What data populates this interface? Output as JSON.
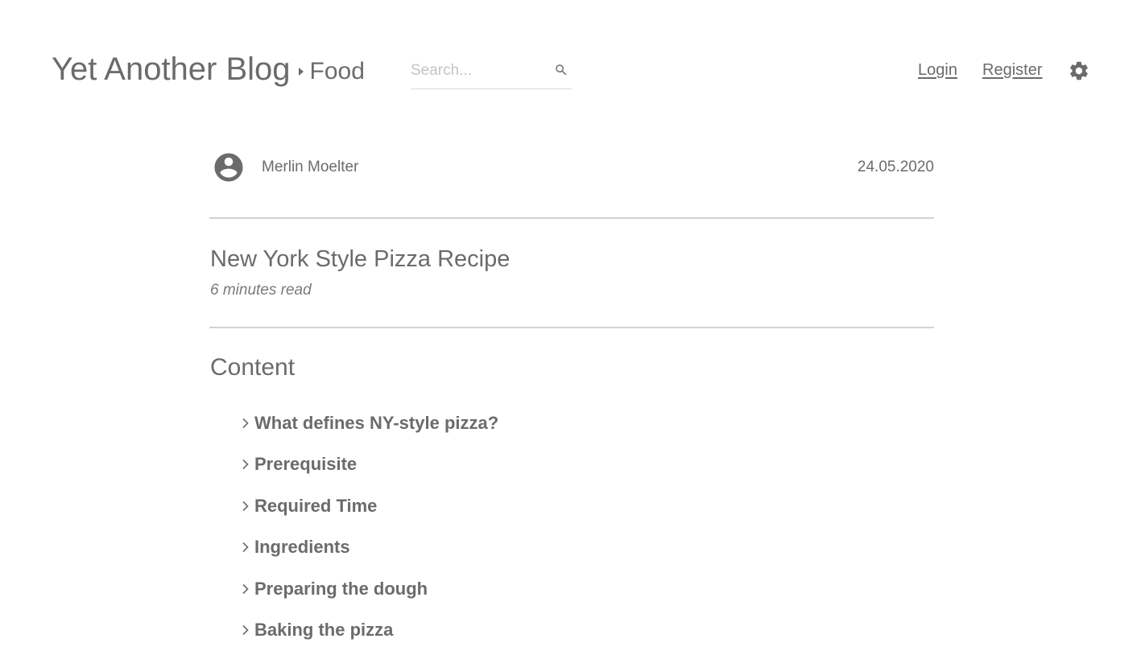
{
  "header": {
    "brand_title": "Yet Another Blog",
    "category": "Food",
    "search_placeholder": "Search...",
    "search_value": "",
    "login_label": "Login",
    "register_label": "Register"
  },
  "post": {
    "author": "Merlin Moelter",
    "date": "24.05.2020",
    "title": "New York Style Pizza Recipe",
    "read_time": "6 minutes read"
  },
  "toc": {
    "heading": "Content",
    "items": [
      {
        "label": "What defines NY-style pizza?"
      },
      {
        "label": "Prerequisite"
      },
      {
        "label": "Required Time"
      },
      {
        "label": "Ingredients"
      },
      {
        "label": "Preparing the dough"
      },
      {
        "label": "Baking the pizza"
      }
    ]
  },
  "icons": {
    "search": "search-icon",
    "settings": "gear-icon",
    "avatar": "account-circle-icon",
    "breadcrumb": "caret-right-icon",
    "toc_item": "chevron-right-icon"
  },
  "colors": {
    "text": "#6b6b6b",
    "divider": "#d3d3d3",
    "placeholder": "#c4c4c4"
  }
}
